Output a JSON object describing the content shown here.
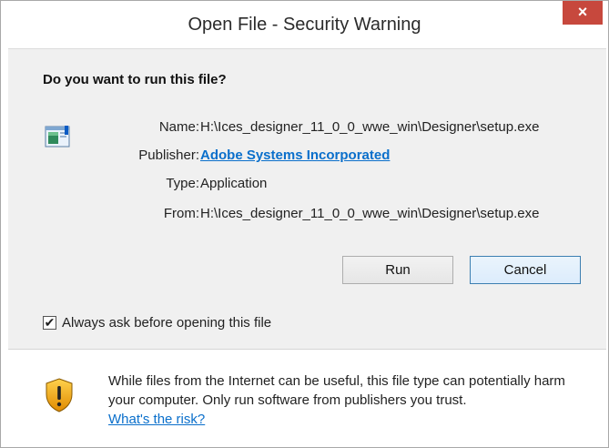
{
  "window": {
    "title": "Open File - Security Warning",
    "close_label": "×"
  },
  "dialog": {
    "question": "Do you want to run this file?",
    "fields": [
      {
        "label": "Name:",
        "value": "H:\\Ices_designer_11_0_0_wwe_win\\Designer\\setup.exe"
      },
      {
        "label": "Publisher:",
        "value": "Adobe Systems Incorporated"
      },
      {
        "label": "Type:",
        "value": "Application"
      },
      {
        "label": "From:",
        "value": "H:\\Ices_designer_11_0_0_wwe_win\\Designer\\setup.exe"
      }
    ],
    "buttons": {
      "run": "Run",
      "cancel": "Cancel"
    },
    "checkbox": {
      "label": "Always ask before opening this file",
      "checked": true,
      "mark": "✔"
    },
    "warning": {
      "text": "While files from the Internet can be useful, this file type can potentially harm your computer. Only run software from publishers you trust.",
      "link": "What's the risk?"
    }
  },
  "colors": {
    "close_button": "#c7483d",
    "link": "#0a6fcb",
    "client_background": "#f0f0f0"
  },
  "icons": [
    "application-icon",
    "shield-warning-icon",
    "close-icon",
    "checkmark-icon"
  ]
}
